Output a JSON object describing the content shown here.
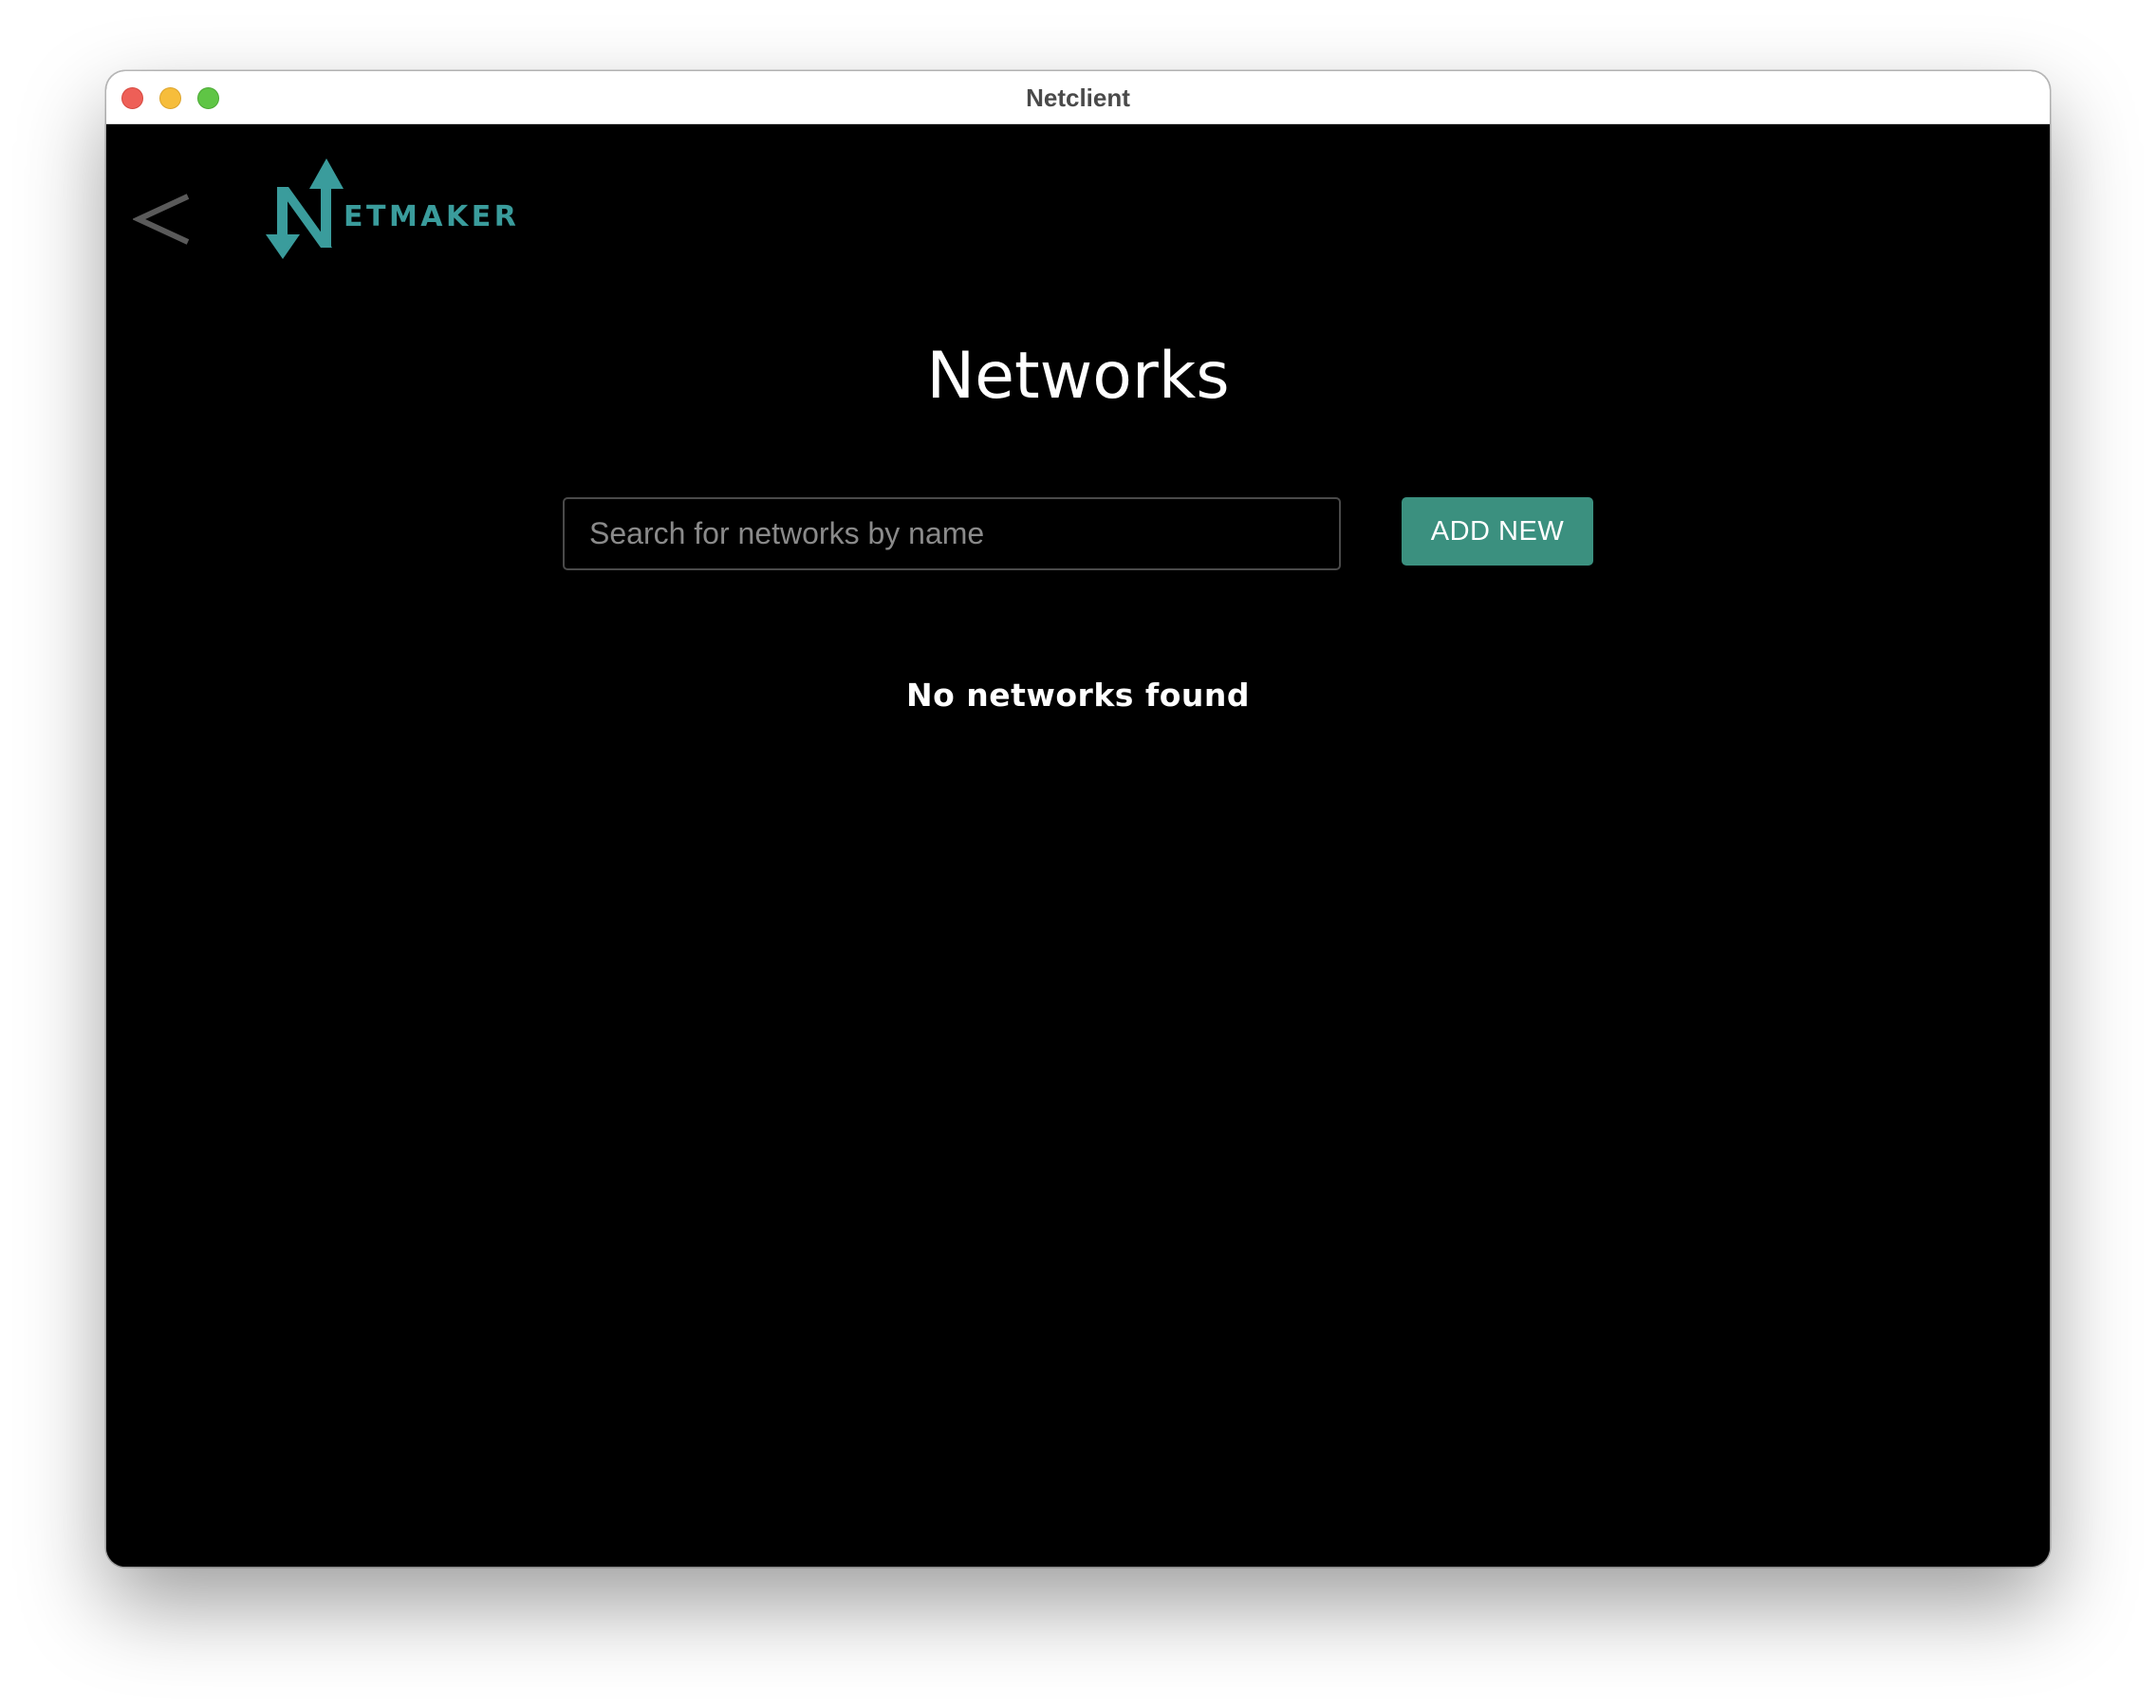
{
  "window": {
    "title": "Netclient"
  },
  "header": {
    "back_icon": "chevron-left-icon",
    "logo_text": "ETMAKER",
    "logo_alt": "Netmaker"
  },
  "main": {
    "title": "Networks",
    "search": {
      "placeholder": "Search for networks by name",
      "value": ""
    },
    "add_button_label": "ADD NEW",
    "empty_message": "No networks found"
  },
  "colors": {
    "brand_teal": "#3a9c9c",
    "button_teal": "#3b907f",
    "background": "#000000",
    "text": "#ffffff"
  }
}
